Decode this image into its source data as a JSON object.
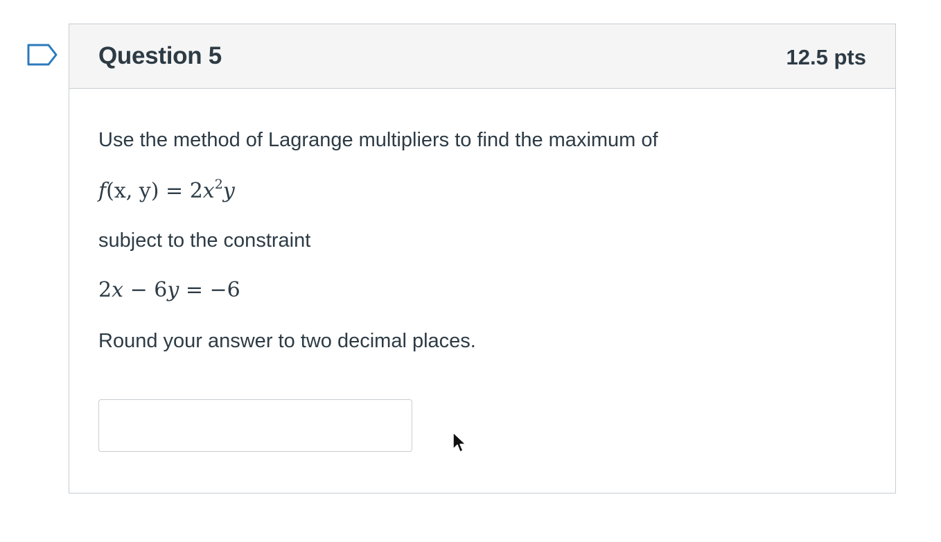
{
  "question": {
    "title": "Question 5",
    "points": "12.5 pts",
    "prompt_line1": "Use the method of Lagrange multipliers to find the maximum of",
    "function": {
      "f": "f",
      "args": "(x, y)",
      "equals": "=",
      "coef": "2",
      "var": "x",
      "exp": "2",
      "tail": "y"
    },
    "prompt_line2": "subject to the constraint",
    "constraint": {
      "lhs_coef1": "2",
      "lhs_var1": "x",
      "minus": "−",
      "lhs_coef2": "6",
      "lhs_var2": "y",
      "equals": "=",
      "rhs": "−6"
    },
    "prompt_line3": "Round your answer to two decimal places.",
    "answer": {
      "value": "",
      "placeholder": ""
    }
  },
  "icons": {
    "flag": "flag-question-icon",
    "cursor": "mouse-pointer-icon"
  },
  "colors": {
    "flag_accent": "#2b7abc",
    "text": "#2d3b45",
    "header_bg": "#f5f5f5",
    "border": "#c7cdd1"
  }
}
